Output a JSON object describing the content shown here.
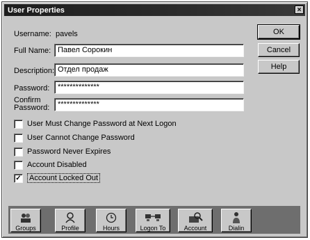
{
  "window": {
    "title": "User Properties",
    "close_glyph": "×"
  },
  "form": {
    "username_label": "Username:",
    "username_value": "pavels",
    "fullname_label": "Full Name:",
    "fullname_value": "Павел Сорокин",
    "description_label": "Description:",
    "description_value": "Отдел продаж",
    "password_label": "Password:",
    "password_value": "**************",
    "confirm_label_1": "Confirm",
    "confirm_label_2": "Password:",
    "confirm_value": "**************"
  },
  "checkboxes": [
    {
      "label": "User Must Change Password at Next Logon",
      "checked": false
    },
    {
      "label": "User Cannot Change Password",
      "checked": false
    },
    {
      "label": "Password Never Expires",
      "checked": false
    },
    {
      "label": "Account Disabled",
      "checked": false
    },
    {
      "label": "Account Locked Out",
      "checked": true
    }
  ],
  "check_glyph": "✓",
  "side_buttons": {
    "ok": "OK",
    "cancel": "Cancel",
    "help": "Help"
  },
  "toolbar": [
    {
      "label": "Groups",
      "icon": "groups-icon"
    },
    {
      "label": "Profile",
      "icon": "profile-icon"
    },
    {
      "label": "Hours",
      "icon": "clock-icon"
    },
    {
      "label": "Logon To",
      "icon": "logon-to-icon"
    },
    {
      "label": "Account",
      "icon": "account-icon"
    },
    {
      "label": "Dialin",
      "icon": "dialin-icon"
    }
  ]
}
